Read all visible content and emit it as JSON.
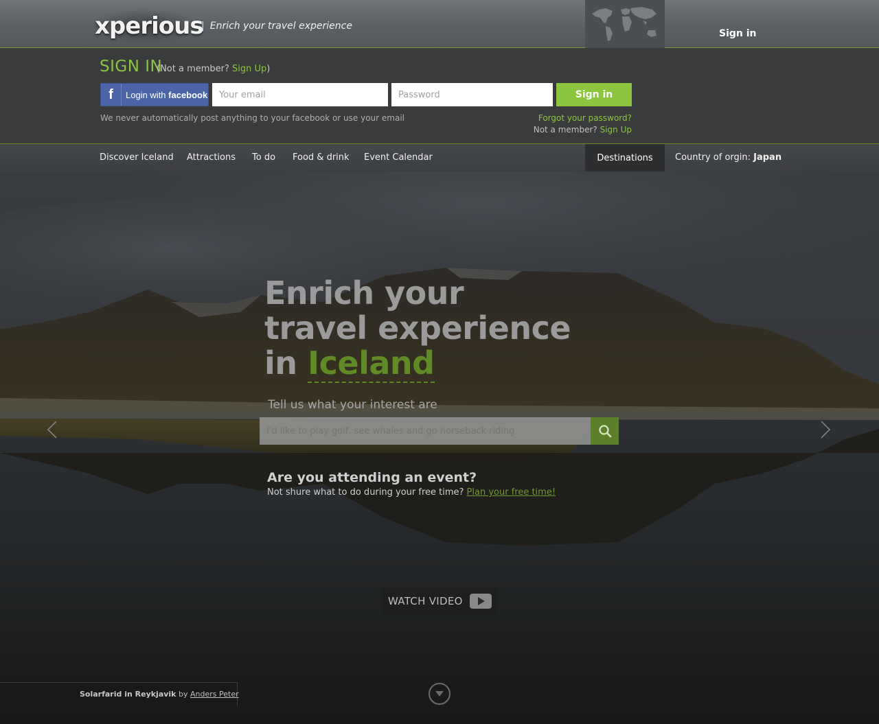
{
  "brand": {
    "logo_text": "xperious",
    "tagline_sep": "|",
    "tagline": "Enrich your travel experience"
  },
  "topbar": {
    "signin_label": "Sign in",
    "map_icon": "world-map-icon"
  },
  "signin_panel": {
    "title": "SIGN IN",
    "sub_prefix": "(Not a member? ",
    "sub_link": "Sign Up",
    "sub_suffix": ")",
    "facebook_prefix": "Login with ",
    "facebook_bold": "facebook",
    "email_placeholder": "Your email",
    "password_placeholder": "Password",
    "signin_button": "Sign in",
    "disclaimer": "We never automatically post anything to your facebook or use your email",
    "forgot_password": "Forgot your password?",
    "not_member_prefix": "Not a member? ",
    "not_member_link": "Sign Up"
  },
  "nav": {
    "items": [
      "Discover Iceland",
      "Attractions",
      "To do",
      "Food & drink",
      "Event Calendar"
    ],
    "destinations": "Destinations",
    "country_label": "Country of orgin: ",
    "country_value": "Japan"
  },
  "hero": {
    "headline_line1": "Enrich your",
    "headline_line2": "travel experience",
    "headline_line3_prefix": "in ",
    "headline_highlight": "Iceland",
    "interest_label": "Tell us what your interest are",
    "search_placeholder": "I'd like to play golf, see whales and go horseback riding",
    "event_title": "Are you attending an event?",
    "event_sub_prefix": "Not shure what to do during your free time? ",
    "event_sub_link": "Plan your free time!",
    "watch_video": "WATCH VIDEO"
  },
  "footer": {
    "photo_title": "Solarfarid in Reykjavik",
    "photo_by": " by ",
    "photo_author": "Anders Peter"
  },
  "colors": {
    "accent_green": "#8cc63f",
    "panel_dark": "#3a3b3c",
    "facebook_blue": "#4a66a8"
  }
}
